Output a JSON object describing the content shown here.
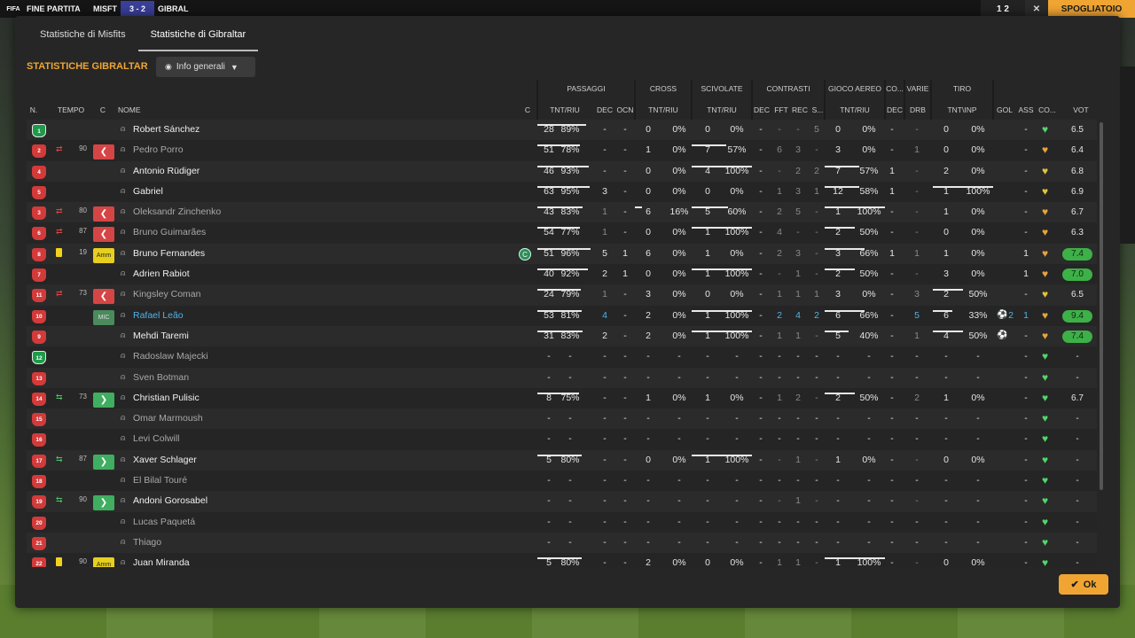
{
  "header": {
    "logo": "FIFA",
    "phase": "FINE PARTITA",
    "home": "MISFT",
    "score": "3 - 2",
    "away": "GIBRAL",
    "right_score": "1 2",
    "close": "✕",
    "dressing_room": "SPOGLIATOIO"
  },
  "tabs": [
    {
      "label": "Statistiche di Misfits",
      "active": false
    },
    {
      "label": "Statistiche di Gibraltar",
      "active": true
    }
  ],
  "section_title": "STATISTICHE GIBRALTAR",
  "dropdown": {
    "label": "Info generali"
  },
  "groups": {
    "passaggi": "PASSAGGI",
    "cross": "CROSS",
    "scivolate": "SCIVOLATE",
    "contrasti": "CONTRASTI",
    "aereo": "GIOCO AEREO",
    "co": "CO...",
    "varie": "VARIE",
    "tiro": "TIRO"
  },
  "columns": {
    "n": "N.",
    "tempo": "TEMPO",
    "c": "C",
    "nome": "NOME",
    "c2": "C",
    "p_tnt": "TNT/RIU",
    "p_dec": "DEC",
    "p_ocn": "OCN",
    "cr_tnt": "TNT/RIU",
    "sc_tnt": "TNT/RIU",
    "ct_dec": "DEC",
    "ct_fft": "FFT",
    "ct_rec": "REC",
    "ct_s": "S...",
    "ae_tnt": "TNT/RIU",
    "co_dec": "DEC",
    "va_drb": "DRB",
    "ti_tnt": "TNT\\INP",
    "gol": "GOL",
    "ass": "ASS",
    "cond": "CO...",
    "vot": "VOT"
  },
  "players": [
    {
      "num": "1",
      "gk": true,
      "sub": "",
      "min": "",
      "badge": "",
      "ycard": false,
      "name": "Robert Sánchez",
      "dim": false,
      "link": false,
      "cap": false,
      "p1": "28",
      "p2": "89%",
      "pr": 0.89,
      "pdec": "-",
      "pocn": "-",
      "c1": "0",
      "c2": "0%",
      "cr": 0,
      "s1": "0",
      "s2": "0%",
      "sr": 0,
      "t1": "-",
      "t2": "-",
      "t3": "-",
      "t4": "5",
      "a1": "0",
      "a2": "0%",
      "ar": 0,
      "codec": "-",
      "drb": "-",
      "ti1": "0",
      "ti2": "0%",
      "tr": 0,
      "gol": "",
      "ass": "-",
      "cond": "#4fd86a",
      "vot": "6.5",
      "hi": false
    },
    {
      "num": "2",
      "gk": false,
      "sub": "out",
      "min": "90",
      "badge": "out",
      "ycard": false,
      "name": "Pedro Porro",
      "dim": true,
      "link": false,
      "cap": false,
      "p1": "51",
      "p2": "78%",
      "pr": 0.78,
      "pdec": "-",
      "pocn": "-",
      "c1": "1",
      "c2": "0%",
      "cr": 0,
      "s1": "7",
      "s2": "57%",
      "sr": 0.57,
      "t1": "-",
      "t2": "6",
      "t3": "3",
      "t4": "-",
      "a1": "3",
      "a2": "0%",
      "ar": 0,
      "codec": "-",
      "drb": "1",
      "ti1": "0",
      "ti2": "0%",
      "tr": 0,
      "gol": "",
      "ass": "-",
      "cond": "#e8a43a",
      "vot": "6.4",
      "hi": false
    },
    {
      "num": "4",
      "gk": false,
      "sub": "",
      "min": "",
      "badge": "",
      "ycard": false,
      "name": "Antonio Rüdiger",
      "dim": false,
      "link": false,
      "cap": false,
      "p1": "46",
      "p2": "93%",
      "pr": 0.93,
      "pdec": "-",
      "pocn": "-",
      "c1": "0",
      "c2": "0%",
      "cr": 0,
      "s1": "4",
      "s2": "100%",
      "sr": 1,
      "t1": "-",
      "t2": "-",
      "t3": "2",
      "t4": "2",
      "a1": "7",
      "a2": "57%",
      "ar": 0.57,
      "codec": "1",
      "drb": "-",
      "ti1": "2",
      "ti2": "0%",
      "tr": 0,
      "gol": "",
      "ass": "-",
      "cond": "#e0c43a",
      "vot": "6.8",
      "hi": false
    },
    {
      "num": "5",
      "gk": false,
      "sub": "",
      "min": "",
      "badge": "",
      "ycard": false,
      "name": "Gabriel",
      "dim": false,
      "link": false,
      "cap": false,
      "p1": "63",
      "p2": "95%",
      "pr": 0.95,
      "pdec": "3",
      "pocn": "-",
      "c1": "0",
      "c2": "0%",
      "cr": 0,
      "s1": "0",
      "s2": "0%",
      "sr": 0,
      "t1": "-",
      "t2": "1",
      "t3": "3",
      "t4": "1",
      "a1": "12",
      "a2": "58%",
      "ar": 0.58,
      "codec": "1",
      "drb": "-",
      "ti1": "1",
      "ti2": "100%",
      "tr": 1,
      "gol": "",
      "ass": "-",
      "cond": "#e0c43a",
      "vot": "6.9",
      "hi": false
    },
    {
      "num": "3",
      "gk": false,
      "sub": "out",
      "min": "80",
      "badge": "out",
      "ycard": false,
      "name": "Oleksandr Zinchenko",
      "dim": true,
      "link": false,
      "cap": false,
      "p1": "43",
      "p2": "83%",
      "pr": 0.83,
      "pdec": "1",
      "pocn": "-",
      "c1": "6",
      "c2": "16%",
      "cr": 0.16,
      "s1": "5",
      "s2": "60%",
      "sr": 0.6,
      "t1": "-",
      "t2": "2",
      "t3": "5",
      "t4": "-",
      "a1": "1",
      "a2": "100%",
      "ar": 1,
      "codec": "-",
      "drb": "-",
      "ti1": "1",
      "ti2": "0%",
      "tr": 0,
      "gol": "",
      "ass": "-",
      "cond": "#e8a43a",
      "vot": "6.7",
      "hi": false
    },
    {
      "num": "6",
      "gk": false,
      "sub": "out",
      "min": "87",
      "badge": "out",
      "ycard": false,
      "name": "Bruno Guimarães",
      "dim": true,
      "link": false,
      "cap": false,
      "p1": "54",
      "p2": "77%",
      "pr": 0.77,
      "pdec": "1",
      "pocn": "-",
      "c1": "0",
      "c2": "0%",
      "cr": 0,
      "s1": "1",
      "s2": "100%",
      "sr": 1,
      "t1": "-",
      "t2": "4",
      "t3": "-",
      "t4": "-",
      "a1": "2",
      "a2": "50%",
      "ar": 0.5,
      "codec": "-",
      "drb": "-",
      "ti1": "0",
      "ti2": "0%",
      "tr": 0,
      "gol": "",
      "ass": "-",
      "cond": "#e8a43a",
      "vot": "6.3",
      "hi": false
    },
    {
      "num": "8",
      "gk": false,
      "sub": "",
      "min": "19",
      "badge": "amm",
      "ycard": true,
      "name": "Bruno Fernandes",
      "dim": false,
      "link": false,
      "cap": true,
      "p1": "51",
      "p2": "96%",
      "pr": 0.96,
      "pdec": "5",
      "pocn": "1",
      "c1": "6",
      "c2": "0%",
      "cr": 0,
      "s1": "1",
      "s2": "0%",
      "sr": 0,
      "t1": "-",
      "t2": "2",
      "t3": "3",
      "t4": "-",
      "a1": "3",
      "a2": "66%",
      "ar": 0.66,
      "codec": "1",
      "drb": "1",
      "ti1": "1",
      "ti2": "0%",
      "tr": 0,
      "gol": "",
      "ass": "1",
      "cond": "#e8a43a",
      "vot": "7.4",
      "hi": true
    },
    {
      "num": "7",
      "gk": false,
      "sub": "",
      "min": "",
      "badge": "",
      "ycard": false,
      "name": "Adrien Rabiot",
      "dim": false,
      "link": false,
      "cap": false,
      "p1": "40",
      "p2": "92%",
      "pr": 0.92,
      "pdec": "2",
      "pocn": "1",
      "c1": "0",
      "c2": "0%",
      "cr": 0,
      "s1": "1",
      "s2": "100%",
      "sr": 1,
      "t1": "-",
      "t2": "-",
      "t3": "1",
      "t4": "-",
      "a1": "2",
      "a2": "50%",
      "ar": 0.5,
      "codec": "-",
      "drb": "-",
      "ti1": "3",
      "ti2": "0%",
      "tr": 0,
      "gol": "",
      "ass": "1",
      "cond": "#e8a43a",
      "vot": "7.0",
      "hi": true
    },
    {
      "num": "11",
      "gk": false,
      "sub": "out",
      "min": "73",
      "badge": "out",
      "ycard": false,
      "name": "Kingsley Coman",
      "dim": true,
      "link": false,
      "cap": false,
      "p1": "24",
      "p2": "79%",
      "pr": 0.79,
      "pdec": "1",
      "pocn": "-",
      "c1": "3",
      "c2": "0%",
      "cr": 0,
      "s1": "0",
      "s2": "0%",
      "sr": 0,
      "t1": "-",
      "t2": "1",
      "t3": "1",
      "t4": "1",
      "a1": "3",
      "a2": "0%",
      "ar": 0,
      "codec": "-",
      "drb": "3",
      "ti1": "2",
      "ti2": "50%",
      "tr": 0.5,
      "gol": "",
      "ass": "-",
      "cond": "#e0c43a",
      "vot": "6.5",
      "hi": false
    },
    {
      "num": "10",
      "gk": false,
      "sub": "",
      "min": "",
      "badge": "mic",
      "ycard": false,
      "name": "Rafael Leão",
      "dim": false,
      "link": true,
      "cap": false,
      "p1": "53",
      "p2": "81%",
      "pr": 0.81,
      "pdec": "4",
      "pocn": "-",
      "c1": "2",
      "c2": "0%",
      "cr": 0,
      "s1": "1",
      "s2": "100%",
      "sr": 1,
      "t1": "-",
      "t2": "2",
      "t3": "4",
      "t4": "2",
      "a1": "6",
      "a2": "66%",
      "ar": 0.66,
      "codec": "-",
      "drb": "5",
      "ti1": "6",
      "ti2": "33%",
      "tr": 0.33,
      "gol": "2",
      "ass": "1",
      "cond": "#e8a43a",
      "vot": "9.4",
      "hi": true,
      "blue": true
    },
    {
      "num": "9",
      "gk": false,
      "sub": "",
      "min": "",
      "badge": "",
      "ycard": false,
      "name": "Mehdi Taremi",
      "dim": false,
      "link": false,
      "cap": false,
      "p1": "31",
      "p2": "83%",
      "pr": 0.83,
      "pdec": "2",
      "pocn": "-",
      "c1": "2",
      "c2": "0%",
      "cr": 0,
      "s1": "1",
      "s2": "100%",
      "sr": 1,
      "t1": "-",
      "t2": "1",
      "t3": "1",
      "t4": "-",
      "a1": "5",
      "a2": "40%",
      "ar": 0.4,
      "codec": "-",
      "drb": "1",
      "ti1": "4",
      "ti2": "50%",
      "tr": 0.5,
      "gol": "",
      "ass": "-",
      "cond": "#e8a43a",
      "vot": "7.4",
      "hi": true,
      "ballonly": true
    },
    {
      "num": "12",
      "gk": true,
      "sub": "",
      "min": "",
      "badge": "",
      "ycard": false,
      "name": "Radoslaw Majecki",
      "dim": true,
      "link": false,
      "cap": false,
      "empty": true,
      "cond": "#4fd86a",
      "vot": "-"
    },
    {
      "num": "13",
      "gk": false,
      "sub": "",
      "min": "",
      "badge": "",
      "ycard": false,
      "name": "Sven Botman",
      "dim": true,
      "link": false,
      "cap": false,
      "empty": true,
      "cond": "#4fd86a",
      "vot": "-"
    },
    {
      "num": "14",
      "gk": false,
      "sub": "in",
      "min": "73",
      "badge": "in",
      "ycard": false,
      "name": "Christian Pulisic",
      "dim": false,
      "link": false,
      "cap": false,
      "p1": "8",
      "p2": "75%",
      "pr": 0.75,
      "pdec": "-",
      "pocn": "-",
      "c1": "1",
      "c2": "0%",
      "cr": 0,
      "s1": "1",
      "s2": "0%",
      "sr": 0,
      "t1": "-",
      "t2": "1",
      "t3": "2",
      "t4": "-",
      "a1": "2",
      "a2": "50%",
      "ar": 0.5,
      "codec": "-",
      "drb": "2",
      "ti1": "1",
      "ti2": "0%",
      "tr": 0,
      "gol": "",
      "ass": "-",
      "cond": "#4fd86a",
      "vot": "6.7",
      "hi": false
    },
    {
      "num": "15",
      "gk": false,
      "sub": "",
      "min": "",
      "badge": "",
      "ycard": false,
      "name": "Omar Marmoush",
      "dim": true,
      "link": false,
      "cap": false,
      "empty": true,
      "cond": "#4fd86a",
      "vot": "-"
    },
    {
      "num": "16",
      "gk": false,
      "sub": "",
      "min": "",
      "badge": "",
      "ycard": false,
      "name": "Levi Colwill",
      "dim": true,
      "link": false,
      "cap": false,
      "empty": true,
      "cond": "#4fd86a",
      "vot": "-"
    },
    {
      "num": "17",
      "gk": false,
      "sub": "in",
      "min": "87",
      "badge": "in",
      "ycard": false,
      "name": "Xaver Schlager",
      "dim": false,
      "link": false,
      "cap": false,
      "p1": "5",
      "p2": "80%",
      "pr": 0.8,
      "pdec": "-",
      "pocn": "-",
      "c1": "0",
      "c2": "0%",
      "cr": 0,
      "s1": "1",
      "s2": "100%",
      "sr": 1,
      "t1": "-",
      "t2": "-",
      "t3": "1",
      "t4": "-",
      "a1": "1",
      "a2": "0%",
      "ar": 0,
      "codec": "-",
      "drb": "-",
      "ti1": "0",
      "ti2": "0%",
      "tr": 0,
      "gol": "",
      "ass": "-",
      "cond": "#4fd86a",
      "vot": "-",
      "hi": false
    },
    {
      "num": "18",
      "gk": false,
      "sub": "",
      "min": "",
      "badge": "",
      "ycard": false,
      "name": "El Bilal Touré",
      "dim": true,
      "link": false,
      "cap": false,
      "empty": true,
      "cond": "#4fd86a",
      "vot": "-"
    },
    {
      "num": "19",
      "gk": false,
      "sub": "in",
      "min": "90",
      "badge": "in",
      "ycard": false,
      "name": "Andoni Gorosabel",
      "dim": false,
      "link": false,
      "cap": false,
      "p1": "-",
      "p2": "-",
      "pr": 0,
      "pdec": "-",
      "pocn": "-",
      "c1": "-",
      "c2": "-",
      "cr": 0,
      "s1": "-",
      "s2": "-",
      "sr": 0,
      "t1": "-",
      "t2": "-",
      "t3": "1",
      "t4": "-",
      "a1": "-",
      "a2": "-",
      "ar": 0,
      "codec": "-",
      "drb": "-",
      "ti1": "-",
      "ti2": "-",
      "tr": 0,
      "gol": "",
      "ass": "-",
      "cond": "#4fd86a",
      "vot": "-",
      "hi": false
    },
    {
      "num": "20",
      "gk": false,
      "sub": "",
      "min": "",
      "badge": "",
      "ycard": false,
      "name": "Lucas Paquetá",
      "dim": true,
      "link": false,
      "cap": false,
      "empty": true,
      "cond": "#4fd86a",
      "vot": "-"
    },
    {
      "num": "21",
      "gk": false,
      "sub": "",
      "min": "",
      "badge": "",
      "ycard": false,
      "name": "Thiago",
      "dim": true,
      "link": false,
      "cap": false,
      "empty": true,
      "cond": "#4fd86a",
      "vot": "-"
    },
    {
      "num": "22",
      "gk": false,
      "sub": "",
      "min": "90",
      "badge": "amm",
      "ycard": true,
      "name": "Juan Miranda",
      "dim": false,
      "link": false,
      "cap": false,
      "p1": "5",
      "p2": "80%",
      "pr": 0.8,
      "pdec": "-",
      "pocn": "-",
      "c1": "2",
      "c2": "0%",
      "cr": 0,
      "s1": "0",
      "s2": "0%",
      "sr": 0,
      "t1": "-",
      "t2": "1",
      "t3": "1",
      "t4": "-",
      "a1": "1",
      "a2": "100%",
      "ar": 1,
      "codec": "-",
      "drb": "-",
      "ti1": "0",
      "ti2": "0%",
      "tr": 0,
      "gol": "",
      "ass": "-",
      "cond": "#4fd86a",
      "vot": "-",
      "hi": false
    }
  ],
  "badges": {
    "out": "❮",
    "in": "❯",
    "amm": "Amm",
    "mic": "MIC"
  },
  "captain": "C",
  "ok_label": "Ok"
}
